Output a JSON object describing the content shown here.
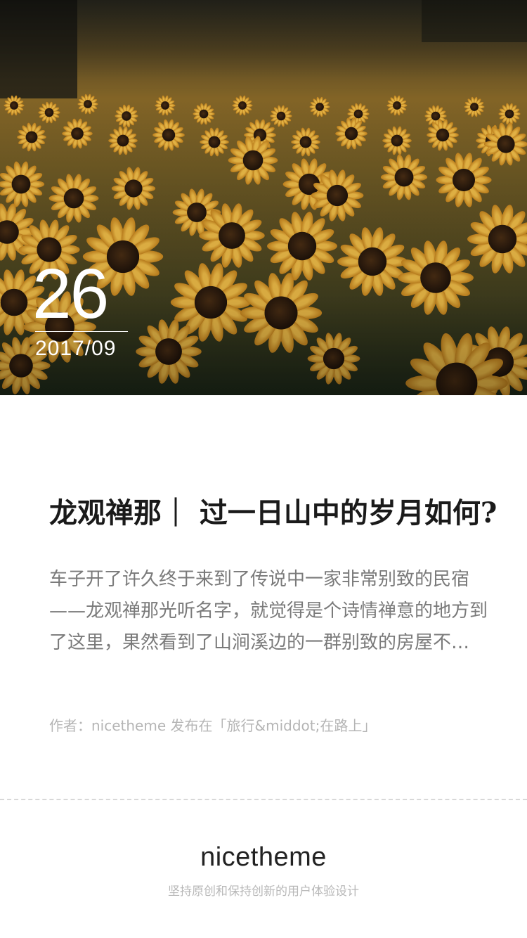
{
  "hero": {
    "image_alt": "向日葵花海",
    "day": "26",
    "year_month": "2017/09"
  },
  "article": {
    "title": "龙观禅那｜ 过一日山中的岁月如何?",
    "excerpt": "车子开了许久终于来到了传说中一家非常别致的民宿——龙观禅那光听名字，就觉得是个诗情禅意的地方到了这里，果然看到了山涧溪边的一群别致的房屋不…",
    "meta": "作者：nicetheme 发布在「旅行&middot;在路上」"
  },
  "footer": {
    "brand": "nicetheme",
    "tagline": "坚持原创和保持创新的用户体验设计"
  },
  "colors": {
    "title": "#1a1a1a",
    "excerpt": "#7a7a7a",
    "meta": "#b5b5b5",
    "sunflower_petal": "#e0a52c",
    "sunflower_center": "#3a2412"
  }
}
